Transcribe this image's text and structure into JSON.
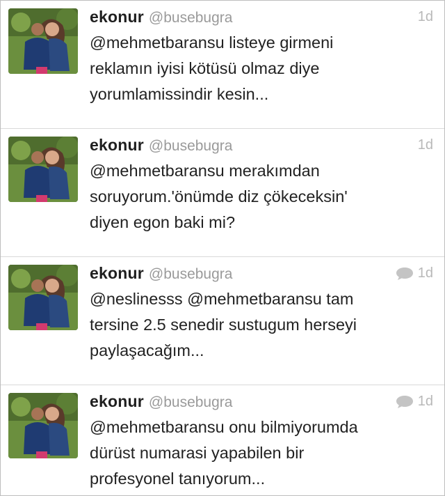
{
  "tweets": [
    {
      "name": "ekonur",
      "handle": "@busebugra",
      "time": "1d",
      "has_conversation": false,
      "lines": [
        "@mehmetbaransu listeye girmeni",
        "reklamın iyisi kötüsü olmaz diye",
        "yorumlamissindir kesin..."
      ]
    },
    {
      "name": "ekonur",
      "handle": "@busebugra",
      "time": "1d",
      "has_conversation": false,
      "lines": [
        "@mehmetbaransu merakımdan",
        "soruyorum.'önümde diz çökeceksin'",
        "diyen egon baki mi?"
      ]
    },
    {
      "name": "ekonur",
      "handle": "@busebugra",
      "time": "1d",
      "has_conversation": true,
      "lines": [
        "@neslinesss @mehmetbaransu tam",
        "tersine 2.5 senedir sustugum herseyi",
        "paylaşacağım..."
      ]
    },
    {
      "name": "ekonur",
      "handle": "@busebugra",
      "time": "1d",
      "has_conversation": true,
      "lines": [
        "@mehmetbaransu onu bilmiyorumda",
        "dürüst numarasi yapabilen bir",
        "profesyonel tanıyorum..."
      ]
    }
  ],
  "icons": {
    "avatar": "profile-photo",
    "conversation": "speech-bubble-icon"
  },
  "colors": {
    "name": "#1f1f1f",
    "handle": "#9a9a9a",
    "timestamp": "#b8b8b8",
    "text": "#222222",
    "divider": "#d9d9d9"
  }
}
